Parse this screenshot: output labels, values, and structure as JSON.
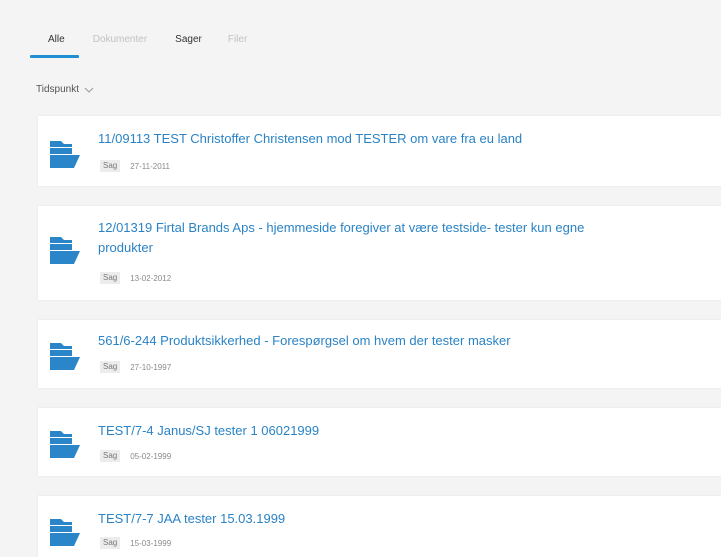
{
  "tabs": [
    {
      "label": "Alle",
      "active": true,
      "faded": false
    },
    {
      "label": "Dokumenter",
      "active": false,
      "faded": true
    },
    {
      "label": "Sager",
      "active": false,
      "faded": false
    },
    {
      "label": "Filer",
      "active": false,
      "faded": true
    }
  ],
  "filter": {
    "label": "Tidspunkt"
  },
  "results": [
    {
      "title": "11/09113 TEST Christoffer Christensen mod TESTER om vare fra eu land",
      "title_line2": "",
      "type": "Sag",
      "date": "27-11-2011"
    },
    {
      "title": "12/01319 Firtal Brands Aps - hjemmeside foregiver at være testside- tester kun egne",
      "title_line2": "produkter",
      "type": "Sag",
      "date": "13-02-2012"
    },
    {
      "title": "561/6-244 Produktsikkerhed - Forespørgsel om hvem der tester masker",
      "title_line2": "",
      "type": "Sag",
      "date": "27-10-1997"
    },
    {
      "title": "TEST/7-4 Janus/SJ tester 1 06021999",
      "title_line2": "",
      "type": "Sag",
      "date": "05-02-1999"
    },
    {
      "title": "TEST/7-7 JAA tester 15.03.1999",
      "title_line2": "",
      "type": "Sag",
      "date": "15-03-1999"
    }
  ],
  "colors": {
    "accent": "#1f8fd2",
    "link": "#2a83c6",
    "background": "#f4f4f4",
    "card": "#ffffff"
  },
  "icons": {
    "result_icon": "folder-icon",
    "filter_icon": "chevron-down-icon"
  }
}
